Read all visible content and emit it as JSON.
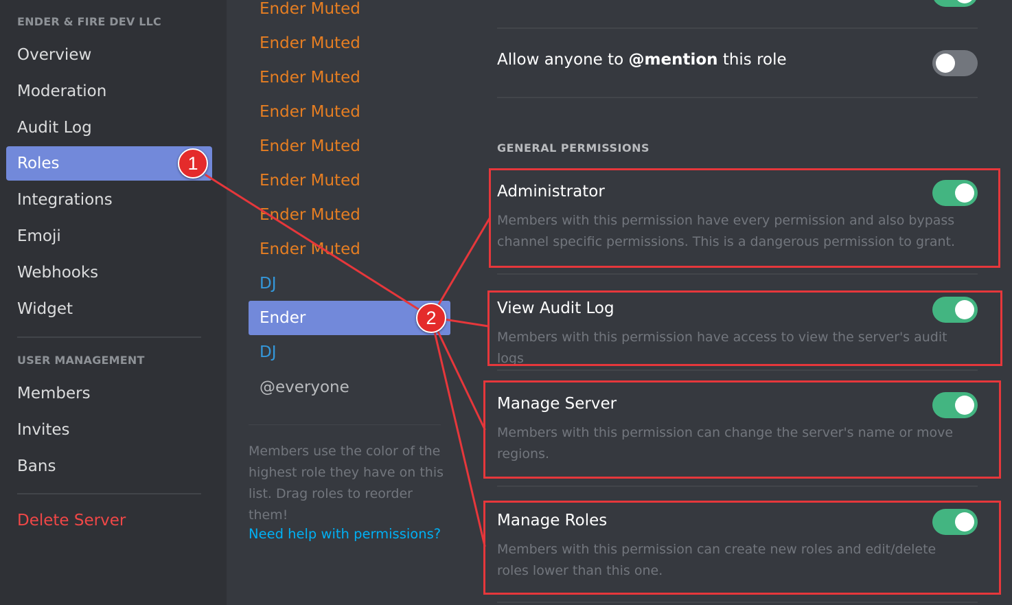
{
  "sidebar": {
    "server_header": "ENDER & FIRE DEV LLC",
    "items": [
      {
        "label": "Overview"
      },
      {
        "label": "Moderation"
      },
      {
        "label": "Audit Log"
      },
      {
        "label": "Roles"
      },
      {
        "label": "Integrations"
      },
      {
        "label": "Emoji"
      },
      {
        "label": "Webhooks"
      },
      {
        "label": "Widget"
      }
    ],
    "user_management_header": "USER MANAGEMENT",
    "user_items": [
      {
        "label": "Members"
      },
      {
        "label": "Invites"
      },
      {
        "label": "Bans"
      }
    ],
    "delete_label": "Delete Server"
  },
  "roles": {
    "list": [
      {
        "label": "Ender Muted"
      },
      {
        "label": "Ender Muted"
      },
      {
        "label": "Ender Muted"
      },
      {
        "label": "Ender Muted"
      },
      {
        "label": "Ender Muted"
      },
      {
        "label": "Ender Muted"
      },
      {
        "label": "Ender Muted"
      },
      {
        "label": "Ender Muted"
      },
      {
        "label": "DJ"
      },
      {
        "label": "Ender"
      },
      {
        "label": "DJ"
      },
      {
        "label": "@everyone"
      }
    ],
    "hint": "Members use the color of the highest role they have on this list. Drag roles to reorder them!",
    "help_link": "Need help with permissions?"
  },
  "permissions": {
    "mention_prefix": "Allow anyone to ",
    "mention_bold": "@mention",
    "mention_suffix": " this role",
    "section_title": "GENERAL PERMISSIONS",
    "items": [
      {
        "title": "Administrator",
        "description": "Members with this permission have every permission and also bypass channel specific permissions. This is a dangerous permission to grant."
      },
      {
        "title": "View Audit Log",
        "description": "Members with this permission have access to view the server's audit logs"
      },
      {
        "title": "Manage Server",
        "description": "Members with this permission can change the server's name or move regions."
      },
      {
        "title": "Manage Roles",
        "description": "Members with this permission can create new roles and edit/delete roles lower than this one."
      }
    ]
  },
  "annotations": {
    "badge_1": "1",
    "badge_2": "2"
  },
  "colors": {
    "accent": "#7289da",
    "toggle_on": "#43b581",
    "role_orange": "#e67e22",
    "role_blue": "#3498db",
    "danger": "#f04747",
    "annotation_red": "#e6373b"
  }
}
